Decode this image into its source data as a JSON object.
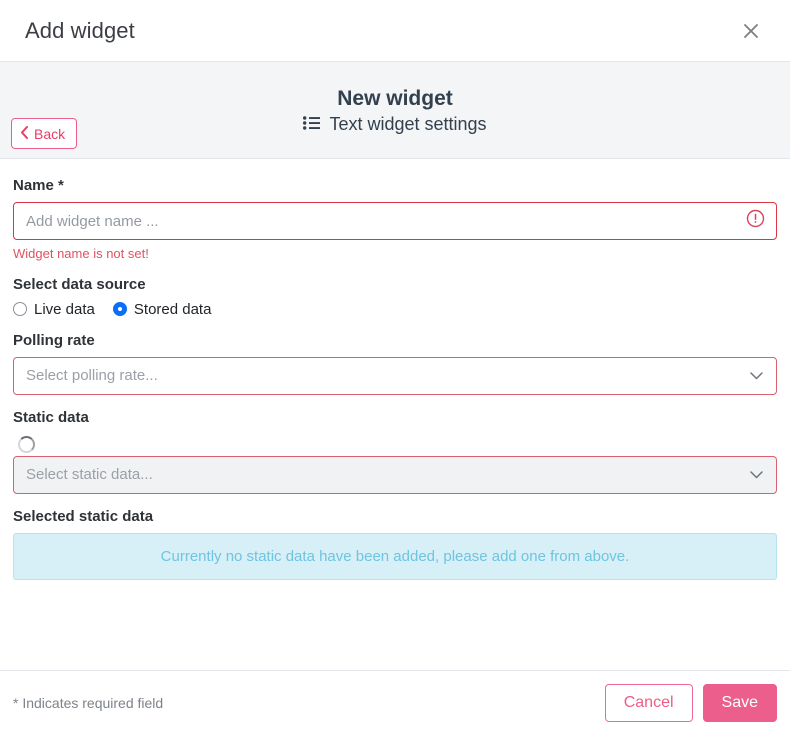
{
  "header": {
    "title": "Add widget",
    "close_icon": "close-icon"
  },
  "sub_header": {
    "title": "New widget",
    "settings_label": "Text widget settings",
    "settings_icon": "list-icon",
    "back_label": "Back",
    "back_icon": "chevron-left-icon"
  },
  "form": {
    "name": {
      "label": "Name *",
      "value": "",
      "placeholder": "Add widget name ...",
      "error": "Widget name is not set!",
      "error_icon": "exclamation-circle-icon"
    },
    "data_source": {
      "label": "Select data source",
      "options": [
        {
          "label": "Live data",
          "selected": false
        },
        {
          "label": "Stored data",
          "selected": true
        }
      ]
    },
    "polling_rate": {
      "label": "Polling rate",
      "value": "",
      "placeholder": "Select polling rate...",
      "caret_icon": "chevron-down-icon"
    },
    "static_data": {
      "label": "Static data",
      "value": "",
      "placeholder": "Select static data...",
      "caret_icon": "chevron-down-icon",
      "loading_icon": "spinner-icon"
    },
    "selected_static_data": {
      "label": "Selected static data",
      "empty_message": "Currently no static data have been added, please add one from above."
    }
  },
  "footer": {
    "required_note": "* Indicates required field",
    "cancel_label": "Cancel",
    "save_label": "Save"
  },
  "colors": {
    "accent_pink": "#ec5f8c",
    "error_red": "#dc3545",
    "radio_blue": "#0b6ef6",
    "info_bg": "#d7eff7",
    "info_text": "#6fc4e0",
    "banner_bg": "#f4f5f7"
  }
}
